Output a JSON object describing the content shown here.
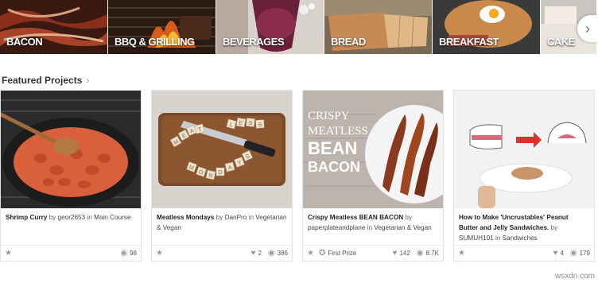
{
  "categories": [
    {
      "label": "BACON"
    },
    {
      "label": "BBQ & GRILLING"
    },
    {
      "label": "BEVERAGES"
    },
    {
      "label": "BREAD"
    },
    {
      "label": "BREAKFAST"
    },
    {
      "label": "CAKE"
    }
  ],
  "section": {
    "title": "Featured Projects"
  },
  "cards": [
    {
      "title": "Shrimp Curry",
      "by": "by",
      "author": "geor2653",
      "in": "in",
      "category": "Main Course",
      "views": "98"
    },
    {
      "title": "Meatless Mondays",
      "by": "by",
      "author": "DanPro",
      "in": "in",
      "category": "Vegetarian & Vegan",
      "favorites": "2",
      "views": "386"
    },
    {
      "title": "Crispy Meatless BEAN BACON",
      "by": "by",
      "author": "paperplateandplane",
      "in": "in",
      "category": "Vegetarian & Vegan",
      "prize": "First Prize",
      "favorites": "142",
      "views": "8.7K",
      "image_text": [
        "CRISPY",
        "MEATLESS",
        "BEAN",
        "BACON"
      ]
    },
    {
      "title": "How to Make 'Uncrustables' Peanut Butter and Jelly Sandwiches.",
      "by": "by",
      "author": "SUMUH101",
      "in": "in",
      "category": "Sandwiches",
      "favorites": "4",
      "views": "179"
    }
  ],
  "image_tiles": {
    "meatless_mondays": [
      "L",
      "E",
      "S",
      "S",
      "M",
      "E",
      "A",
      "T",
      "M",
      "O",
      "N",
      "D",
      "A",
      "Y",
      "S"
    ]
  },
  "watermark": "wsxdn.com",
  "icons": {
    "star": "star-icon",
    "eye": "eye-icon",
    "heart": "heart-icon",
    "ribbon": "ribbon-icon",
    "chevron": "chevron-right-icon"
  }
}
